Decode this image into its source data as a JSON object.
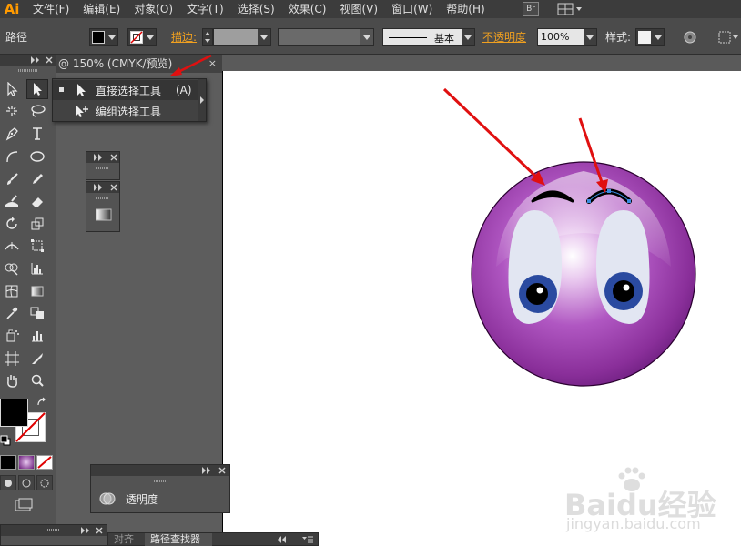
{
  "app": {
    "logo": "Ai"
  },
  "menubar": {
    "items": [
      "文件(F)",
      "编辑(E)",
      "对象(O)",
      "文字(T)",
      "选择(S)",
      "效果(C)",
      "视图(V)",
      "窗口(W)",
      "帮助(H)"
    ],
    "bridge_label": "Br"
  },
  "controlbar": {
    "object_type": "路径",
    "stroke_label": "描边:",
    "brush_label": "基本",
    "opacity_label": "不透明度",
    "opacity_value": "100%",
    "style_label": "样式:"
  },
  "document": {
    "tab_title": "@ 150% (CMYK/预览)",
    "close_glyph": "×"
  },
  "flyout": {
    "items": [
      {
        "label": "直接选择工具",
        "shortcut": "(A)",
        "selected": true
      },
      {
        "label": "编组选择工具",
        "shortcut": "",
        "selected": false
      }
    ]
  },
  "panels": {
    "transparency_title": "透明度",
    "bottom_tabs": [
      "对齐",
      "路径查找器"
    ]
  },
  "artwork": {
    "body_color": "#8a2f9a",
    "eye_color": "#2a4aa0",
    "arrow_color": "#e01010"
  },
  "watermark": {
    "brand": "Baidu经验",
    "url": "jingyan.baidu.com"
  }
}
